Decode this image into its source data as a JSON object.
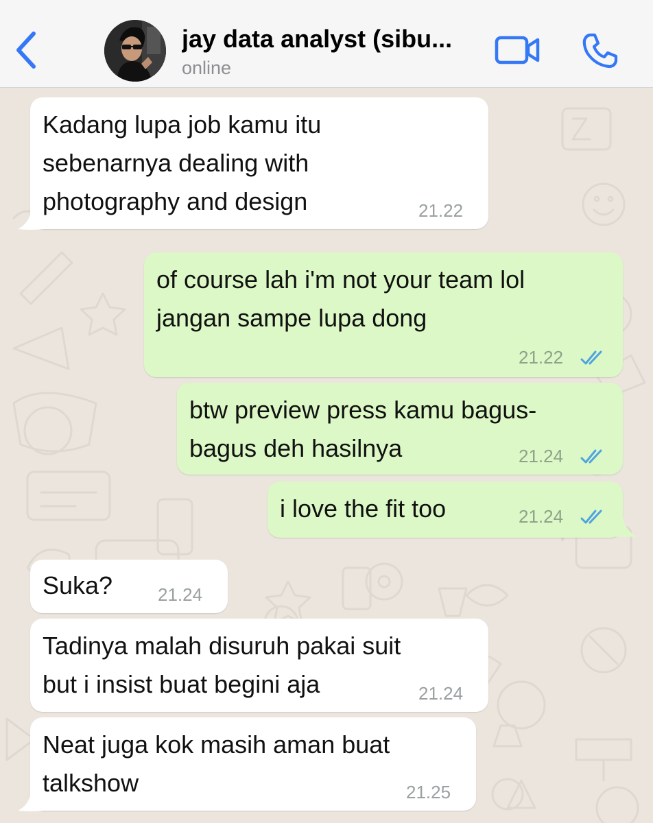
{
  "header": {
    "contact_name": "jay data analyst (sibu...",
    "status": "online",
    "accent_color": "#3478F6",
    "icons": {
      "back": "chevron-left-icon",
      "video": "video-camera-icon",
      "call": "phone-icon"
    }
  },
  "colors": {
    "chat_background": "#ECE5DD",
    "incoming_bubble": "#FFFFFF",
    "outgoing_bubble": "#DCF8C6",
    "read_ticks": "#4FA3E0"
  },
  "messages": [
    {
      "direction": "incoming",
      "text": "Kadang lupa job kamu itu\nsebenarnya dealing with\nphotography and design",
      "time": "21.22"
    },
    {
      "direction": "outgoing",
      "text": "of course lah i'm not your team lol\njangan sampe lupa dong",
      "time": "21.22",
      "status": "read"
    },
    {
      "direction": "outgoing",
      "text": "btw preview press kamu bagus-\nbagus deh hasilnya",
      "time": "21.24",
      "status": "read"
    },
    {
      "direction": "outgoing",
      "text": "i love the fit too",
      "time": "21.24",
      "status": "read"
    },
    {
      "direction": "incoming",
      "text": "Suka?",
      "time": "21.24"
    },
    {
      "direction": "incoming",
      "text": "Tadinya malah disuruh pakai suit\nbut i insist buat begini aja",
      "time": "21.24"
    },
    {
      "direction": "incoming",
      "text": "Neat juga kok masih aman buat\ntalkshow",
      "time": "21.25"
    }
  ]
}
